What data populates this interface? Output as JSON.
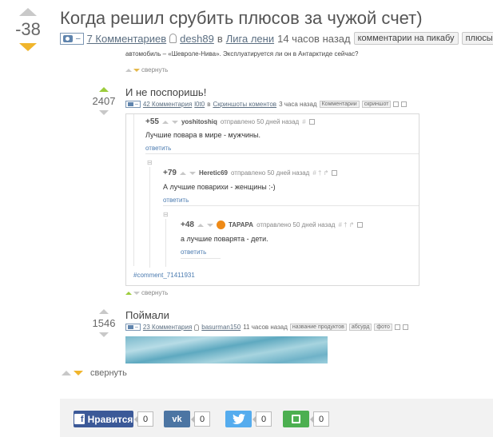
{
  "post": {
    "rating": "-38",
    "title": "Когда решил срубить плюсов за чужой счет)",
    "cam_minus": "–",
    "comments_link": "7 Комментариев",
    "author": "desh89",
    "in_word": "в",
    "community": "Лига лени",
    "time": "14 часов назад",
    "tags": [
      "комментарии на пикабу",
      "плюсы"
    ]
  },
  "prev_story": {
    "text": "автомобиль – «Шевроле-Нива». Эксплуатируется ли он в Антарктиде сейчас?",
    "collapse": "свернуть"
  },
  "story1": {
    "rating": "2407",
    "title": "И не поспоришь!",
    "comments": "42 Комментария",
    "author": "l0t0",
    "in_word": "в",
    "community": "Скриншоты коментов",
    "time": "3 часа назад",
    "tags": [
      "Комментарии",
      "скриншот"
    ],
    "collapse": "свернуть"
  },
  "comments": [
    {
      "score": "+55",
      "user": "yoshitoshiq",
      "sent": "отправлено 50 дней назад",
      "icons": "#",
      "text": "Лучшие повара в мире - мужчины.",
      "reply": "ответить"
    },
    {
      "score": "+79",
      "user": "Heretic69",
      "sent": "отправлено 50 дней назад",
      "icons": "# † ↱",
      "text": "А лучшие поварихи - женщины  :-)",
      "reply": "ответить"
    },
    {
      "score": "+48",
      "user": "TAPAPA",
      "sent": "отправлено 50 дней назад",
      "icons": "# † ↱",
      "text": "а лучшие поварята - дети.",
      "reply": "ответить"
    }
  ],
  "comment_anchor": "#comment_71411931",
  "story2": {
    "rating": "1546",
    "title": "Поймали",
    "comments": "23 Комментария",
    "author": "basurman150",
    "time": "11 часов назад",
    "tags": [
      "название продуктов",
      "абсурд",
      "фото"
    ]
  },
  "collapse_main": "свернуть",
  "share": {
    "facebook_label": "Нравится",
    "facebook_count": "0",
    "vk_count": "0",
    "twitter_count": "0",
    "save_count": "0"
  },
  "colors": {
    "vote_down": "#f0b52c",
    "vote_up_green": "#9ccc3c",
    "facebook": "#3b5998",
    "vk": "#4c75a3",
    "twitter": "#55acee",
    "save": "#4caf50"
  }
}
